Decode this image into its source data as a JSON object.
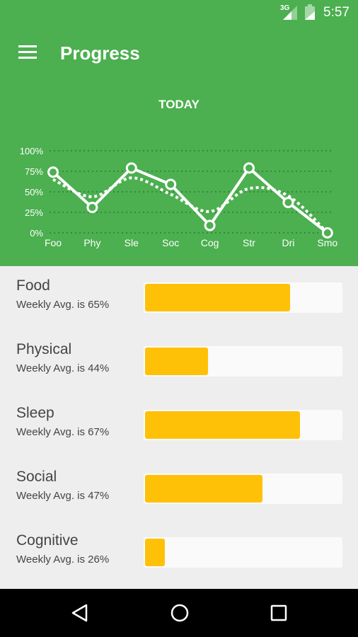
{
  "status": {
    "network": "3G",
    "time": "5:57"
  },
  "header": {
    "title": "Progress",
    "menu_icon": "hamburger-icon"
  },
  "chart_label": "TODAY",
  "colors": {
    "primary": "#4caf50",
    "bar": "#ffc107",
    "track": "#fafafa"
  },
  "chart_data": {
    "type": "line",
    "categories": [
      "Foo",
      "Phy",
      "Sle",
      "Soc",
      "Cog",
      "Str",
      "Dri",
      "Smo"
    ],
    "y_ticks": [
      "0%",
      "25%",
      "50%",
      "75%",
      "100%"
    ],
    "ylim": [
      0,
      100
    ],
    "grid": true,
    "series": [
      {
        "style": "solid-with-markers",
        "values": [
          74,
          31,
          79,
          59,
          9,
          79,
          37,
          0
        ]
      },
      {
        "style": "dotted-smooth",
        "values": [
          65,
          44,
          67,
          47,
          26,
          54,
          45,
          0
        ]
      }
    ]
  },
  "categories": [
    {
      "name": "Food",
      "avg_text": "Weekly Avg. is 65%",
      "today": 74
    },
    {
      "name": "Physical",
      "avg_text": "Weekly Avg. is 44%",
      "today": 32
    },
    {
      "name": "Sleep",
      "avg_text": "Weekly Avg. is 67%",
      "today": 79
    },
    {
      "name": "Social",
      "avg_text": "Weekly Avg. is 47%",
      "today": 60
    },
    {
      "name": "Cognitive",
      "avg_text": "Weekly Avg. is 26%",
      "today": 10
    }
  ]
}
